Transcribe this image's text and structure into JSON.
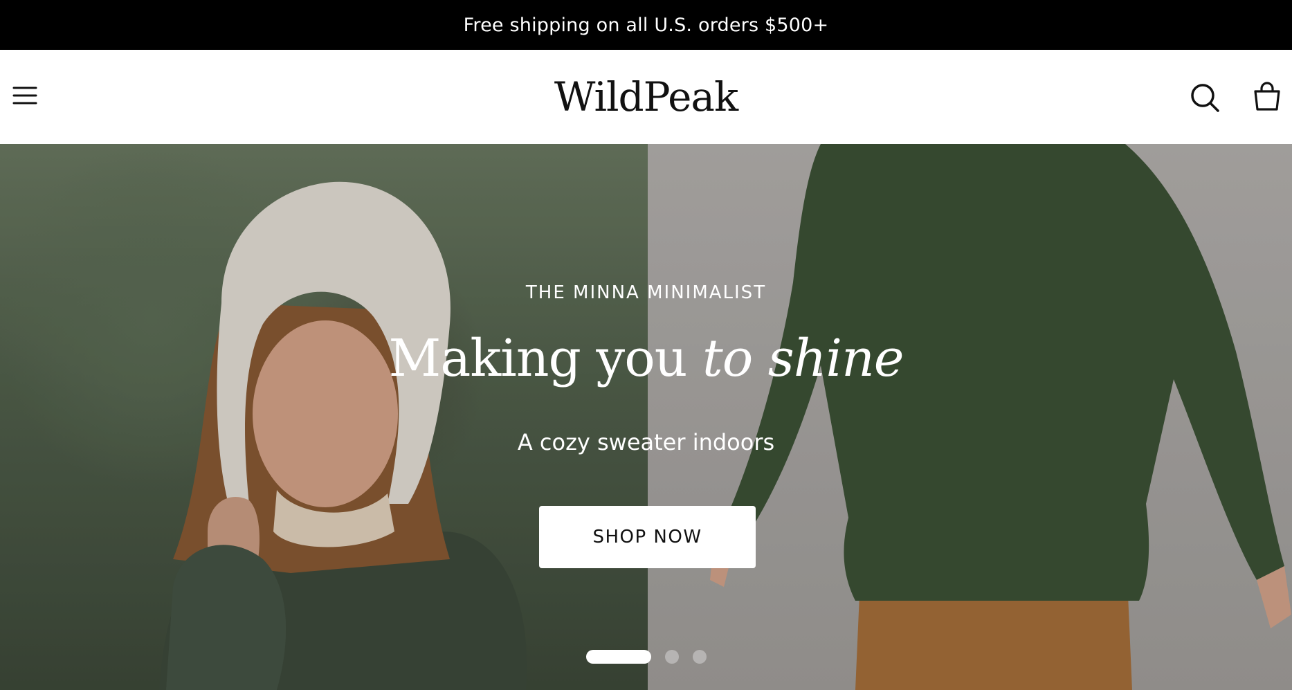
{
  "announcement": {
    "text": "Free shipping on all U.S. orders $500+"
  },
  "header": {
    "logo": "WildPeak",
    "menu_icon": "hamburger-menu-icon",
    "search_icon": "search-icon",
    "cart_icon": "shopping-bag-icon"
  },
  "hero": {
    "eyebrow": "THE MINNA MINIMALIST",
    "headline_regular": "Making you",
    "headline_italic": "to shine",
    "subhead": "A cozy sweater indoors",
    "cta_label": "SHOP NOW",
    "slides_total": 3,
    "active_slide": 1
  },
  "colors": {
    "announcement_bg": "#000000",
    "header_bg": "#ffffff",
    "text_light": "#ffffff",
    "text_dark": "#111111"
  }
}
